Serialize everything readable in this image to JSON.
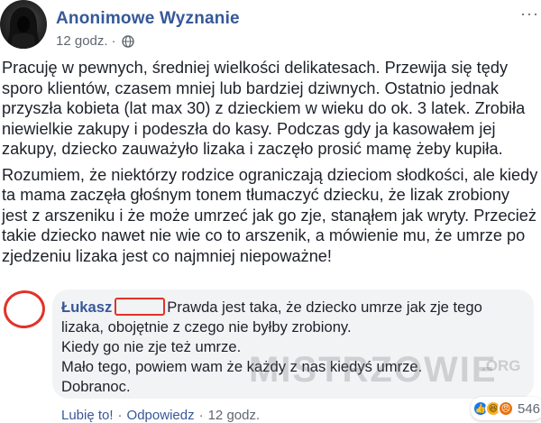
{
  "post": {
    "author": "Anonimowe Wyznanie",
    "time": "12 godz.",
    "separator": "·",
    "more": "···",
    "paragraphs": [
      "Pracuję w pewnych, średniej wielkości delikatesach. Przewija się tędy sporo klientów, czasem mniej lub bardziej dziwnych. Ostatnio jednak przyszła kobieta (lat max 30) z dzieckiem w wieku do ok. 3 latek. Zrobiła niewielkie zakupy i podeszła do kasy. Podczas gdy ja kasowałem jej zakupy, dziecko zauważyło lizaka i zaczęło prosić mamę żeby kupiła.",
      "Rozumiem, że niektórzy rodzice ograniczają dzieciom słodkości, ale kiedy ta mama zaczęła głośnym tonem tłumaczyć dziecku, że lizak zrobiony jest z arszeniku i że może umrzeć jak go zje, stanąłem jak wryty. Przecież takie dziecko nawet nie wie co to arszenik, a mówienie mu, że umrze po zjedzeniu lizaka jest co najmniej niepoważne!"
    ]
  },
  "comment": {
    "author": "Łukasz",
    "lines": [
      "Prawda jest taka, że dziecko umrze jak zje tego",
      "lizaka, obojętnie z czego nie byłby zrobiony.",
      "Kiedy go nie zje też umrze.",
      "Mało tego, powiem wam że każdy z nas kiedyś umrze.",
      "Dobranoc."
    ],
    "reaction_count": "546",
    "like_label": "Lubię to!",
    "reply_label": "Odpowiedz",
    "time": "12 godz.",
    "action_sep": "·"
  },
  "watermark": {
    "main": "MISTRZOWIE",
    "tld": ".ORG"
  },
  "colors": {
    "link_blue": "#365899",
    "redline": "#e2322a",
    "bubble": "#f2f3f5"
  }
}
